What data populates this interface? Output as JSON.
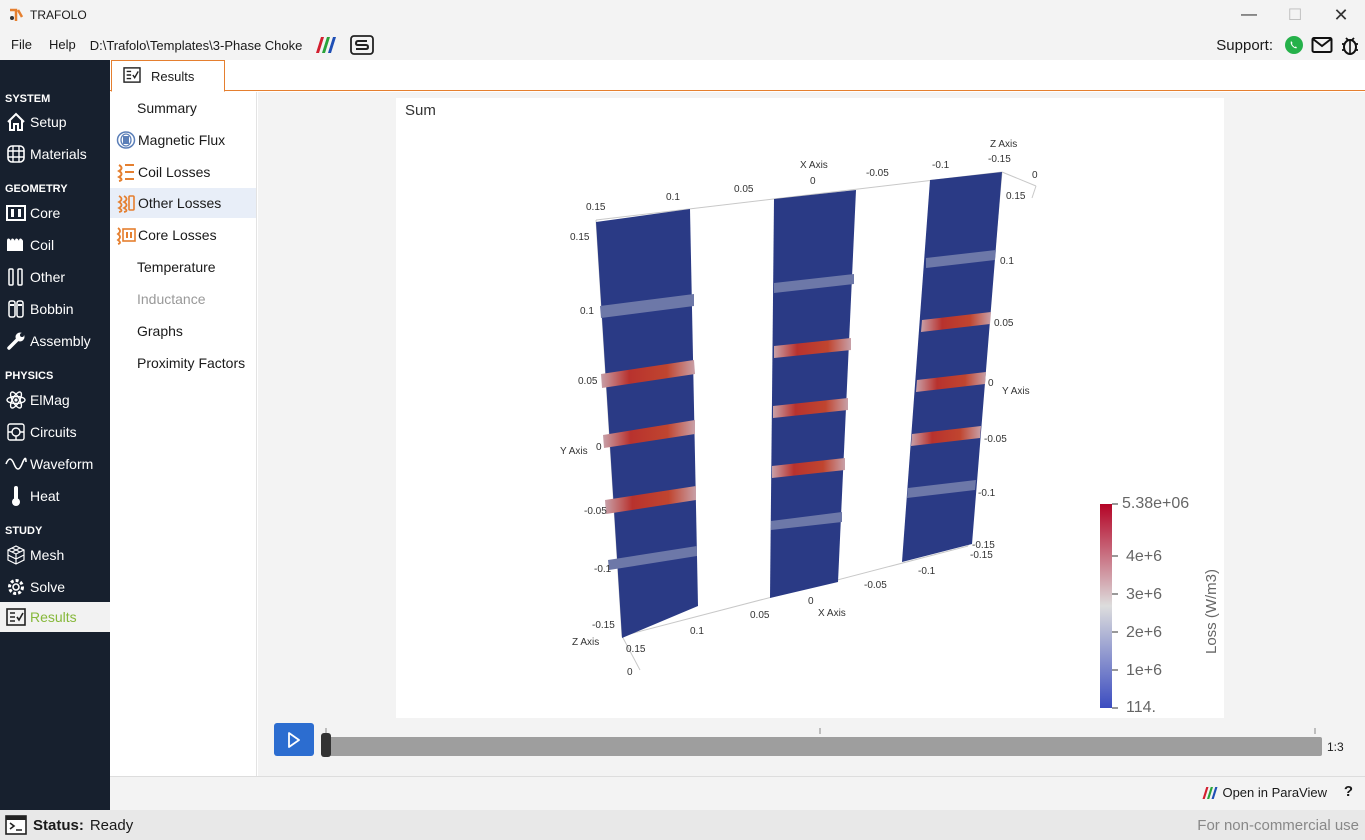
{
  "window": {
    "title": "TRAFOLO",
    "minimize": "—",
    "maximize": "☐",
    "close": "✕"
  },
  "menu": {
    "file": "File",
    "help": "Help",
    "project_path": "D:\\Trafolo\\Templates\\3-Phase Choke",
    "support_label": "Support:"
  },
  "sidebar": {
    "sections": [
      {
        "label": "SYSTEM"
      },
      {
        "label": "GEOMETRY"
      },
      {
        "label": "PHYSICS"
      },
      {
        "label": "STUDY"
      }
    ],
    "items": [
      {
        "label": "Setup",
        "icon": "home-icon"
      },
      {
        "label": "Materials",
        "icon": "grid-icon"
      },
      {
        "label": "Core",
        "icon": "core-icon"
      },
      {
        "label": "Coil",
        "icon": "coil-icon"
      },
      {
        "label": "Other",
        "icon": "other-icon"
      },
      {
        "label": "Bobbin",
        "icon": "bobbin-icon"
      },
      {
        "label": "Assembly",
        "icon": "wrench-icon"
      },
      {
        "label": "ElMag",
        "icon": "atom-icon"
      },
      {
        "label": "Circuits",
        "icon": "circuit-icon"
      },
      {
        "label": "Waveform",
        "icon": "wave-icon"
      },
      {
        "label": "Heat",
        "icon": "thermometer-icon"
      },
      {
        "label": "Mesh",
        "icon": "mesh-icon"
      },
      {
        "label": "Solve",
        "icon": "solve-gear-icon"
      },
      {
        "label": "Results",
        "icon": "results-icon",
        "active": true
      }
    ]
  },
  "tab": {
    "label": "Results"
  },
  "subnav": {
    "items": [
      {
        "label": "Summary"
      },
      {
        "label": "Magnetic Flux"
      },
      {
        "label": "Coil Losses"
      },
      {
        "label": "Other Losses",
        "selected": true
      },
      {
        "label": "Core Losses"
      },
      {
        "label": "Temperature"
      },
      {
        "label": "Inductance",
        "disabled": true
      },
      {
        "label": "Graphs"
      },
      {
        "label": "Proximity Factors"
      }
    ]
  },
  "viewport": {
    "title": "Sum",
    "axes": {
      "x_top_title": "X Axis",
      "x_top_ticks": [
        "0.15",
        "0.1",
        "0.05",
        "0",
        "-0.05",
        "-0.1",
        "-0.15"
      ],
      "z_top_title": "Z Axis",
      "z_top_ticks": [
        "0",
        "0.15"
      ],
      "y_left_title": "Y Axis",
      "y_left_ticks": [
        "0.15",
        "0.1",
        "0.05",
        "0",
        "-0.05",
        "-0.1",
        "-0.15"
      ],
      "y_right_title": "Y Axis",
      "y_right_ticks": [
        "0.1",
        "0.05",
        "0",
        "-0.05",
        "-0.1",
        "-0.15"
      ],
      "x_bottom_title": "X Axis",
      "x_bottom_ticks": [
        "0.1",
        "0.05",
        "0",
        "-0.05",
        "-0.1",
        "-0.15"
      ],
      "z_bottom_title": "Z Axis",
      "z_bottom_ticks": [
        "0.15",
        "0"
      ]
    },
    "colorbar": {
      "title": "Loss (W/m3)",
      "labels": [
        "5.38e+06",
        "4e+6",
        "3e+6",
        "2e+6",
        "1e+6",
        "114."
      ],
      "colors": {
        "high": "#b40426",
        "mid": "#dddddd",
        "low": "#3b4cc0",
        "field": "#2a3a85"
      }
    }
  },
  "timeline": {
    "frame": "1:3",
    "position": 0
  },
  "bottombar": {
    "open_paraview": "Open in ParaView",
    "help": "?"
  },
  "status": {
    "label": "Status:",
    "value": "Ready",
    "license": "For non-commercial use"
  },
  "colors": {
    "accent": "#e57f2f",
    "sidebar": "#17202e",
    "active_green": "#86b83a",
    "play": "#2c6dd0"
  }
}
